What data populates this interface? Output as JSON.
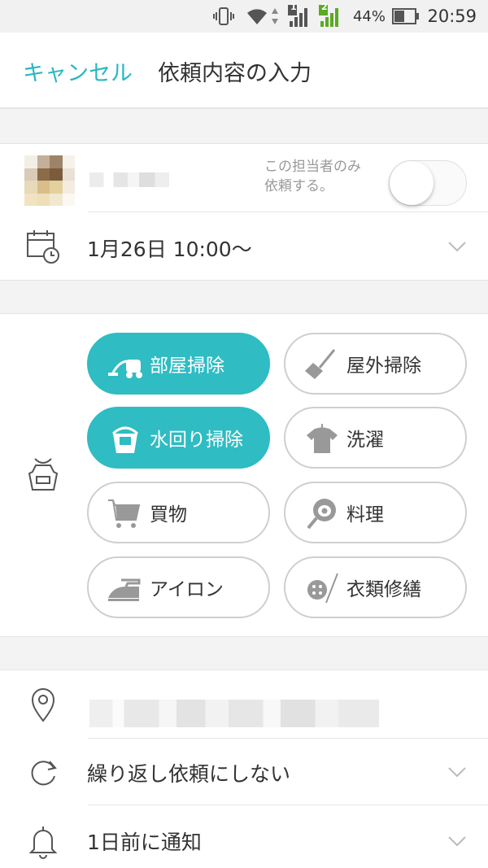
{
  "status_bar": {
    "battery_percent": "44%",
    "time": "20:59",
    "sim1_label": "1",
    "sim2_label": "2"
  },
  "header": {
    "cancel_label": "キャンセル",
    "title": "依頼内容の入力"
  },
  "assignee": {
    "toggle_label_line1": "この担当者のみ",
    "toggle_label_line2": "依頼する。",
    "toggle_on": false
  },
  "schedule": {
    "datetime": "1月26日  10:00〜"
  },
  "services": {
    "items": [
      {
        "label": "部屋掃除",
        "icon": "vacuum-icon",
        "selected": true
      },
      {
        "label": "屋外掃除",
        "icon": "broom-icon",
        "selected": false
      },
      {
        "label": "水回り掃除",
        "icon": "bucket-icon",
        "selected": true
      },
      {
        "label": "洗濯",
        "icon": "shirt-icon",
        "selected": false
      },
      {
        "label": "買物",
        "icon": "cart-icon",
        "selected": false
      },
      {
        "label": "料理",
        "icon": "frying-pan-icon",
        "selected": false
      },
      {
        "label": "アイロン",
        "icon": "iron-icon",
        "selected": false
      },
      {
        "label": "衣類修繕",
        "icon": "needle-button-icon",
        "selected": false
      }
    ]
  },
  "repeat": {
    "value": "繰り返し依頼にしない"
  },
  "notification": {
    "value": "1日前に通知"
  },
  "colors": {
    "accent": "#2bb7c0",
    "selected_pill": "#2fbcc3",
    "icon_gray": "#999999"
  }
}
